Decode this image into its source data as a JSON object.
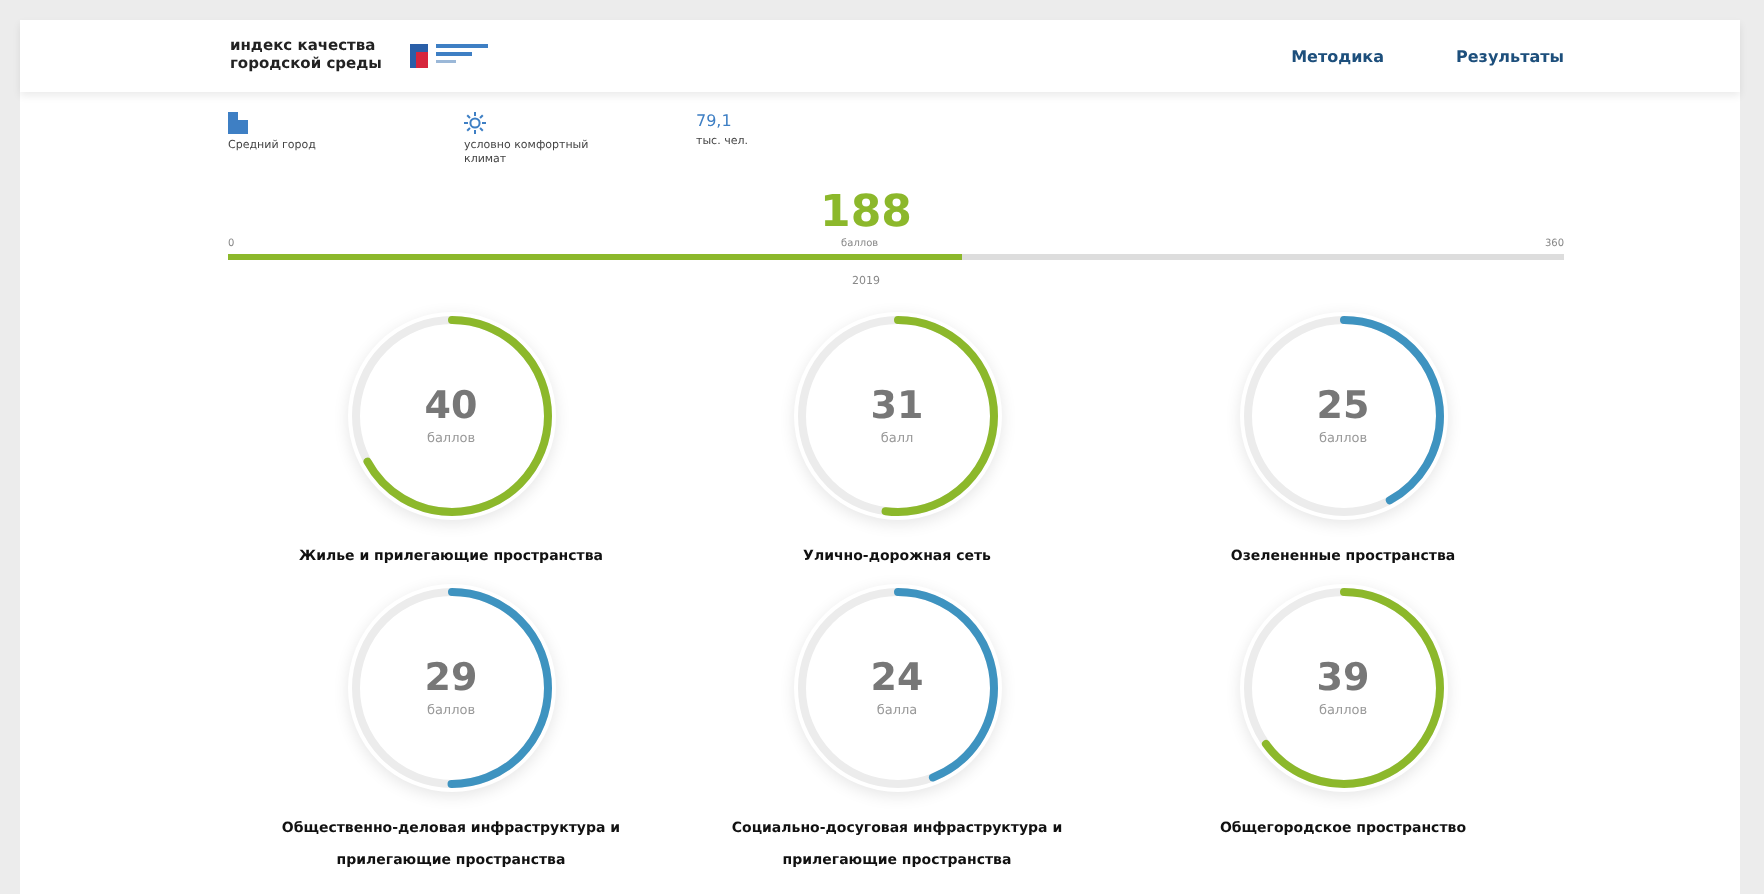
{
  "header": {
    "title_line1": "индекс качества",
    "title_line2": "городской среды",
    "nav": [
      {
        "label": "Методика",
        "selected": false
      },
      {
        "label": "Результаты",
        "selected": false
      }
    ]
  },
  "facts": [
    {
      "kind": "building",
      "label": "Средний город"
    },
    {
      "kind": "sun",
      "label": "условно комфортный климат"
    },
    {
      "kind": "number",
      "value": "79,1",
      "label": "тыс. чел."
    }
  ],
  "total": {
    "score": "188",
    "unit": "баллов",
    "min": "0",
    "max": "360",
    "level": 0.55,
    "year": "2019"
  },
  "indicators": [
    {
      "score": "40",
      "unit": "баллов",
      "level": 0.67,
      "color": "#8cb82b",
      "name": "Жилье и прилегающие пространства"
    },
    {
      "score": "31",
      "unit": "балл",
      "level": 0.52,
      "color": "#8cb82b",
      "name": "Улично-дорожная сеть"
    },
    {
      "score": "25",
      "unit": "баллов",
      "level": 0.42,
      "color": "#3e93c0",
      "name": "Озелененные пространства"
    },
    {
      "score": "29",
      "unit": "баллов",
      "level": 0.5,
      "color": "#3e93c0",
      "name": "Общественно-деловая инфраструктура и прилегающие пространства"
    },
    {
      "score": "24",
      "unit": "балла",
      "level": 0.44,
      "color": "#3e93c0",
      "name": "Социально-досуговая инфраструктура и прилегающие пространства"
    },
    {
      "score": "39",
      "unit": "баллов",
      "level": 0.65,
      "color": "#8cb82b",
      "name": "Общегородское пространство"
    }
  ]
}
